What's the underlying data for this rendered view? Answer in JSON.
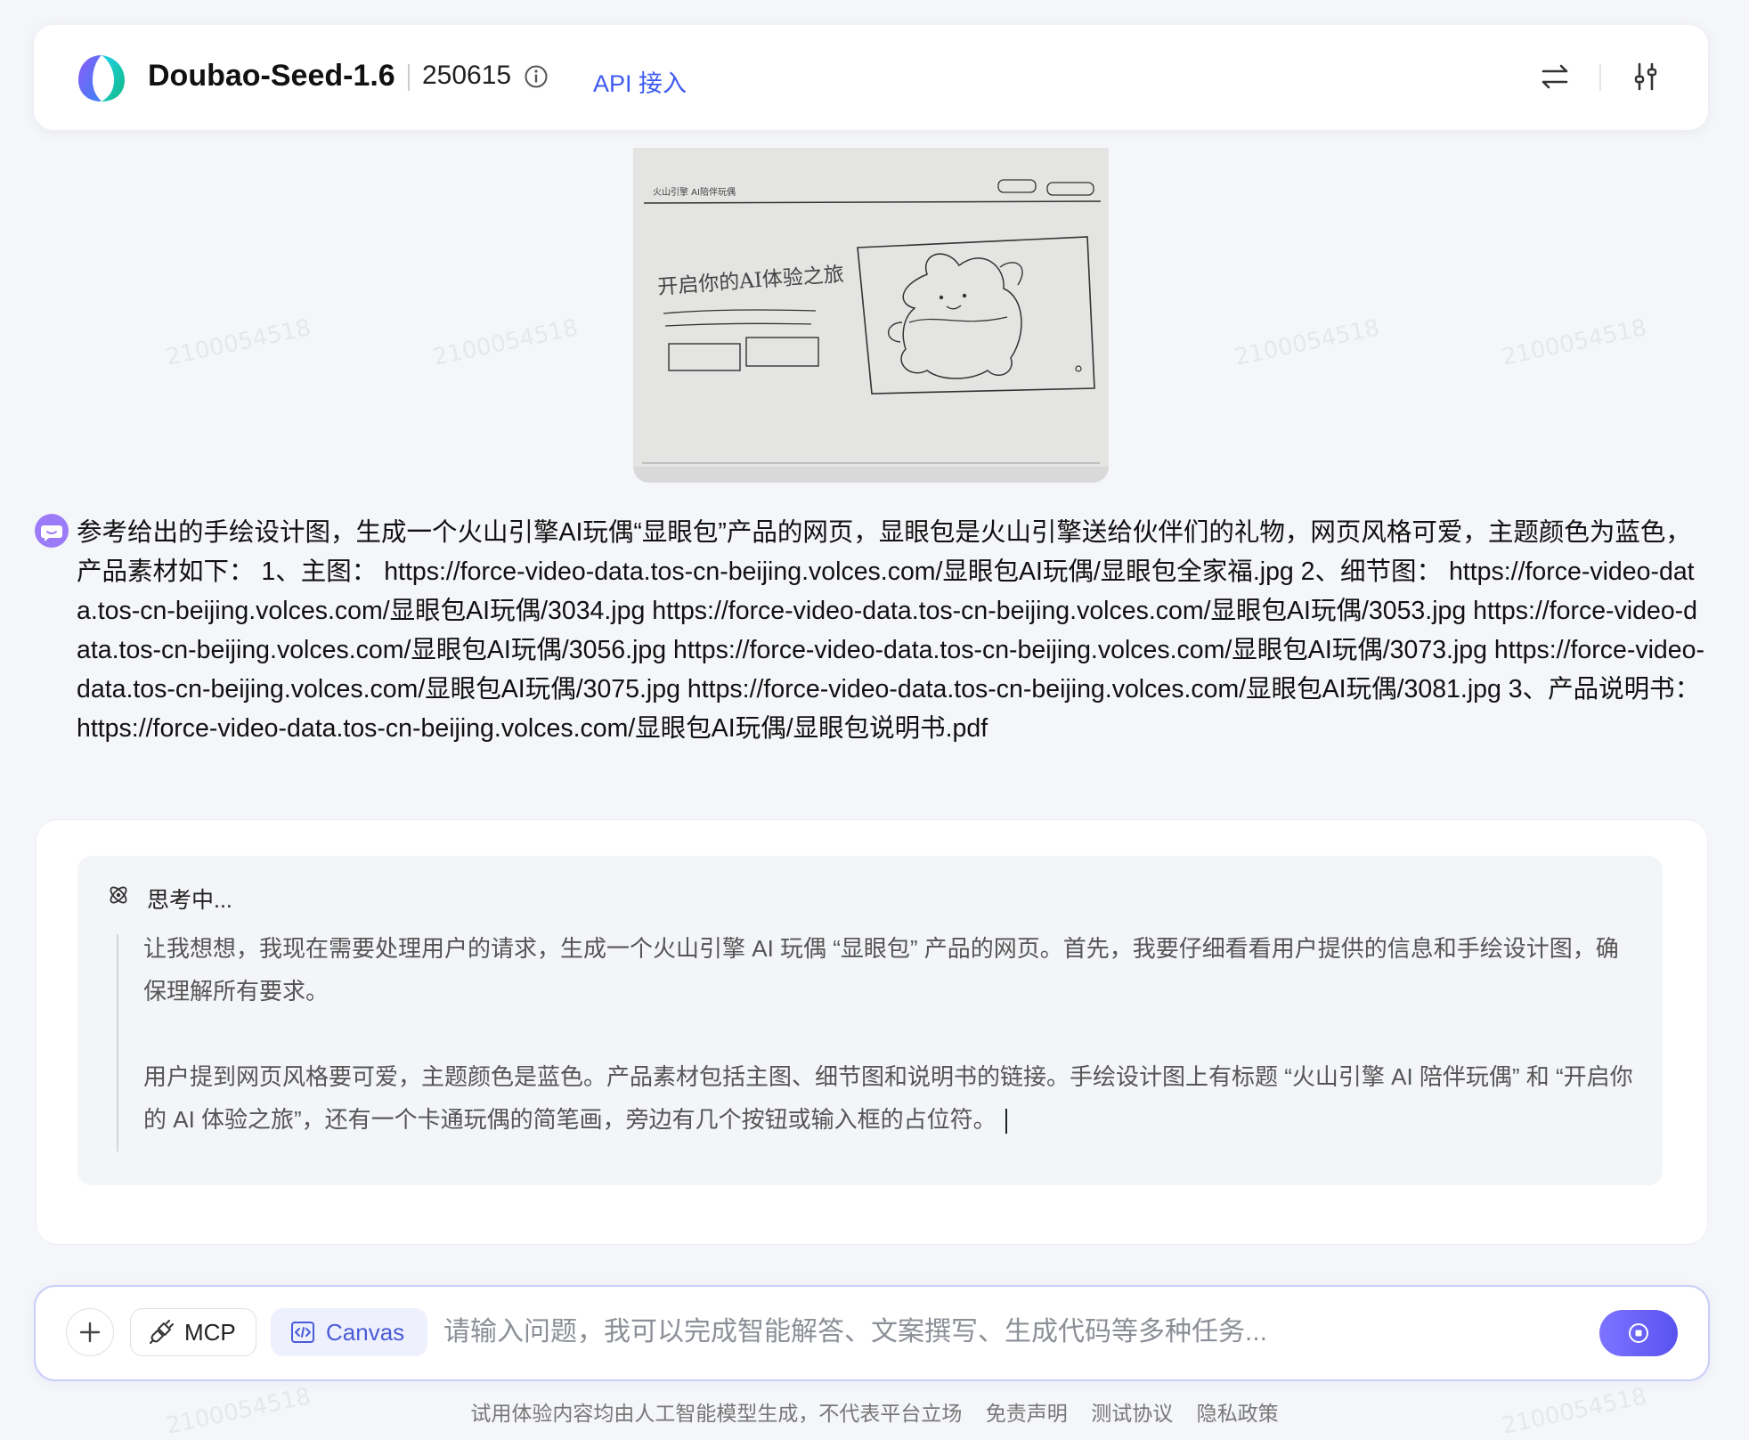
{
  "header": {
    "model_name": "Doubao-Seed-1.6",
    "version": "250615",
    "api_link": "API 接入",
    "icons": [
      "logo-icon",
      "info-icon",
      "swap-icon",
      "settings-sliders-icon"
    ]
  },
  "sketch": {
    "title_text": "火山引擎 AI陪伴玩偶",
    "headline_text": "开启你的AI体验之旅"
  },
  "user_message": {
    "text": "参考给出的手绘设计图，生成一个火山引擎AI玩偶“显眼包”产品的网页，显眼包是火山引擎送给伙伴们的礼物，网页风格可爱，主题颜色为蓝色，产品素材如下： 1、主图： https://force-video-data.tos-cn-beijing.volces.com/显眼包AI玩偶/显眼包全家福.jpg 2、细节图： https://force-video-data.tos-cn-beijing.volces.com/显眼包AI玩偶/3034.jpg https://force-video-data.tos-cn-beijing.volces.com/显眼包AI玩偶/3053.jpg https://force-video-data.tos-cn-beijing.volces.com/显眼包AI玩偶/3056.jpg https://force-video-data.tos-cn-beijing.volces.com/显眼包AI玩偶/3073.jpg https://force-video-data.tos-cn-beijing.volces.com/显眼包AI玩偶/3075.jpg https://force-video-data.tos-cn-beijing.volces.com/显眼包AI玩偶/3081.jpg 3、产品说明书： https://force-video-data.tos-cn-beijing.volces.com/显眼包AI玩偶/显眼包说明书.pdf"
  },
  "assistant": {
    "thinking_label": "思考中...",
    "paragraphs": [
      "让我想想，我现在需要处理用户的请求，生成一个火山引擎 AI 玩偶 “显眼包” 产品的网页。首先，我要仔细看看用户提供的信息和手绘设计图，确保理解所有要求。",
      "用户提到网页风格要可爱，主题颜色是蓝色。产品素材包括主图、细节图和说明书的链接。手绘设计图上有标题 “火山引擎 AI 陪伴玩偶” 和 “开启你的 AI 体验之旅”，还有一个卡通玩偶的简笔画，旁边有几个按钮或输入框的占位符。"
    ]
  },
  "input": {
    "mcp_label": "MCP",
    "canvas_label": "Canvas",
    "placeholder": "请输入问题，我可以完成智能解答、文案撰写、生成代码等多种任务...",
    "value": ""
  },
  "footer": {
    "disclaimer": "试用体验内容均由人工智能模型生成，不代表平台立场",
    "links": [
      "免责声明",
      "测试协议",
      "隐私政策"
    ]
  },
  "watermark_text": "2100054518",
  "colors": {
    "accent": "#3d5af1",
    "send_gradient_start": "#7c74ff",
    "send_gradient_end": "#5a52f0",
    "page_bg": "#f5f6f9",
    "thinking_bg": "#f4f5f8"
  }
}
